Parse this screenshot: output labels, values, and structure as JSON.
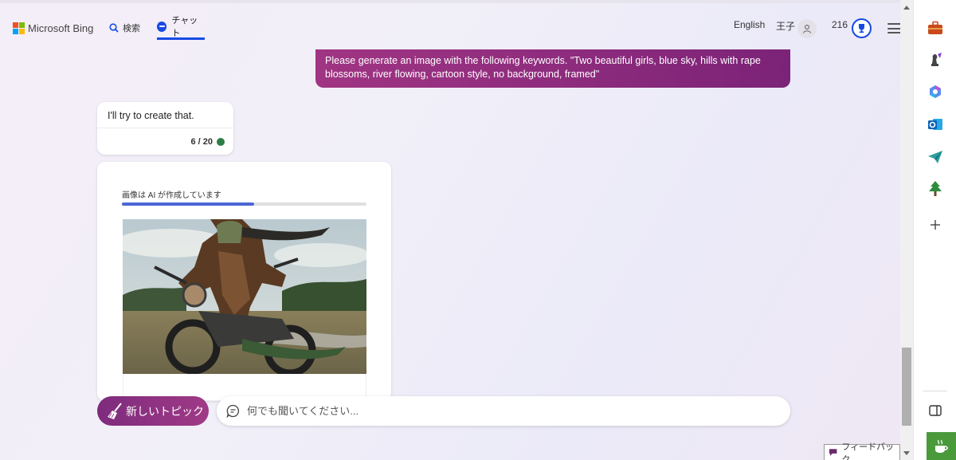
{
  "header": {
    "brand": "Microsoft Bing",
    "nav_search": "検索",
    "nav_chat": "チャット",
    "language": "English",
    "user_name": "王子",
    "points": "216"
  },
  "chat": {
    "user_message": "Please generate an image with the following keywords. \"Two beautiful girls, blue sky, hills with rape blossoms, river flowing, cartoon style, no background, framed\"",
    "bot_reply": "I'll try to create that.",
    "turn_count": "6 / 20",
    "image_card": {
      "progress_label": "画像は AI が作成しています",
      "progress_fraction": 0.54
    }
  },
  "composer": {
    "new_topic_label": "新しいトピック",
    "placeholder": "何でも聞いてください..."
  },
  "feedback_label": "フィードバック",
  "colors": {
    "accent_blue": "#174ae4",
    "user_bubble": "#8b2a7c",
    "status_green": "#2e7d45"
  }
}
